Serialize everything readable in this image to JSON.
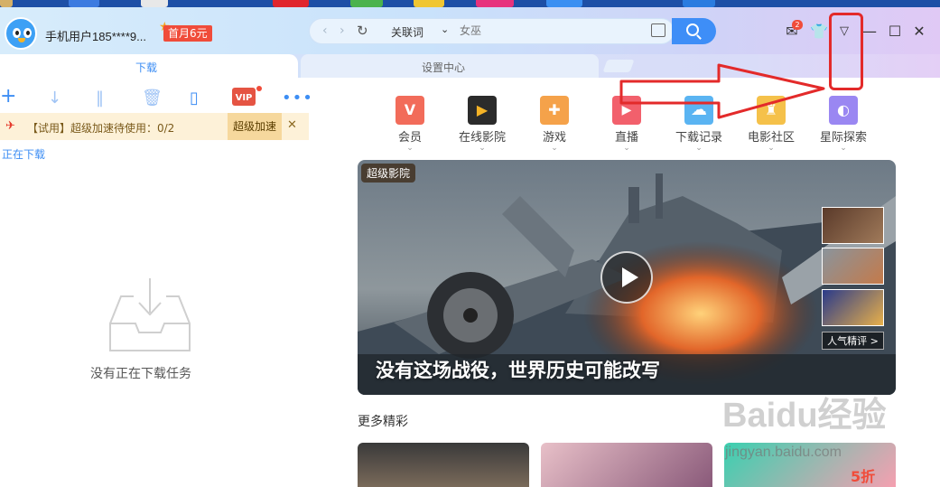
{
  "title_bar": {
    "username": "手机用户185****9...",
    "vip_badge": "首月6元",
    "unread_count": "2"
  },
  "address_bar": {
    "keyword_mode": "关联词",
    "query_placeholder": "女巫"
  },
  "tabs": [
    {
      "label": "下载",
      "active": true
    },
    {
      "label": "设置中心",
      "active": false
    }
  ],
  "download_panel": {
    "vip_icon_text": "VIP",
    "trial_text": "【试用】超级加速待使用：0/2",
    "trial_button": "超级加速",
    "section_label": "正在下载",
    "empty_text": "没有正在下载任务"
  },
  "categories": [
    {
      "label": "会员",
      "color": "#f26c5a",
      "icon": "diamond-v-icon"
    },
    {
      "label": "在线影院",
      "color": "#2b2b2b",
      "icon": "film-icon"
    },
    {
      "label": "游戏",
      "color": "#f5a24a",
      "icon": "gamepad-icon"
    },
    {
      "label": "直播",
      "color": "#f2606c",
      "icon": "live-play-icon"
    },
    {
      "label": "下载记录",
      "color": "#5ab4f2",
      "icon": "cloud-icon"
    },
    {
      "label": "电影社区",
      "color": "#f5c14a",
      "icon": "cinema-community-icon"
    },
    {
      "label": "星际探索",
      "color": "#9a87f2",
      "icon": "planet-icon"
    }
  ],
  "banner": {
    "tag": "超级影院",
    "title": "没有这场战役，世界历史可能改写",
    "side_label": "人气精评 >"
  },
  "more": {
    "title": "更多精彩",
    "card_text": "5折"
  },
  "watermark": {
    "brand": "Baidu经验",
    "url": "jingyan.baidu.com"
  }
}
